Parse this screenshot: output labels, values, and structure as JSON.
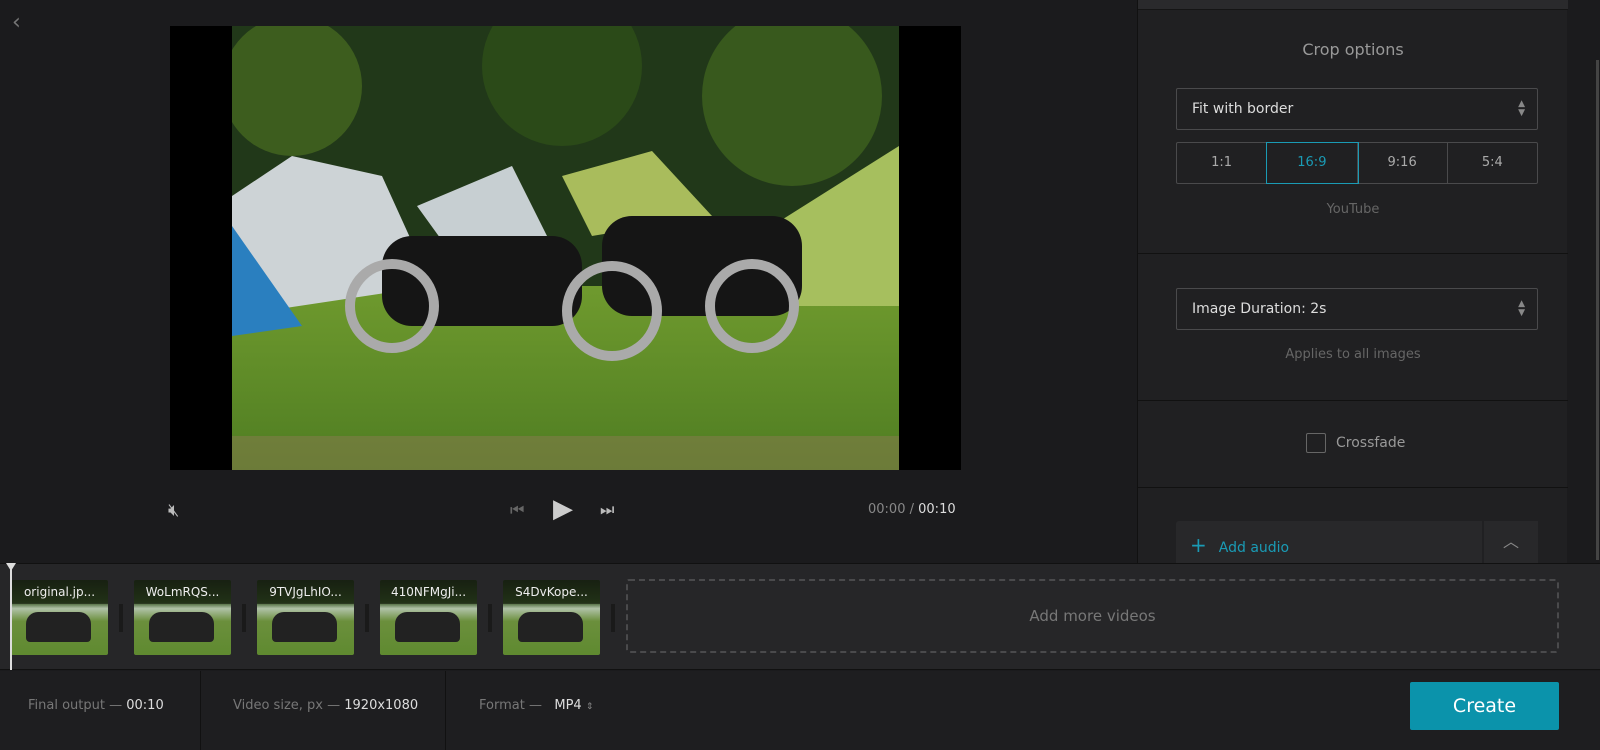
{
  "player": {
    "current_time": "00:00",
    "separator": "/",
    "total_time": "00:10"
  },
  "panel": {
    "crop_title": "Crop options",
    "crop_mode": "Fit with border",
    "ratios": [
      "1:1",
      "16:9",
      "9:16",
      "5:4"
    ],
    "active_ratio": "16:9",
    "ratio_hint": "YouTube",
    "duration": "Image Duration: 2s",
    "duration_hint": "Applies to all images",
    "crossfade_label": "Crossfade",
    "crossfade_checked": false,
    "add_audio": "Add audio"
  },
  "timeline": {
    "clips": [
      "original.jp...",
      "WoLmRQS...",
      "9TVJgLhIO...",
      "410NFMgJi...",
      "S4DvKope..."
    ],
    "add_more": "Add more videos"
  },
  "bottom": {
    "final_label": "Final output —",
    "final_value": "00:10",
    "size_label": "Video size, px —",
    "size_value": "1920x1080",
    "format_label": "Format —",
    "format_value": "MP4",
    "create": "Create"
  },
  "colors": {
    "accent": "#0b93ab"
  }
}
